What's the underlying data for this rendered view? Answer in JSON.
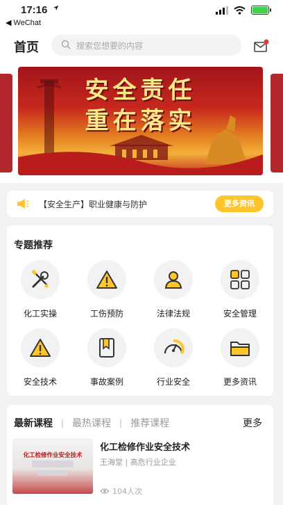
{
  "status": {
    "time": "17:16",
    "back_app": "◀ WeChat"
  },
  "header": {
    "title": "首页",
    "search_placeholder": "搜索您想要的内容"
  },
  "banner": {
    "line1": "安全责任",
    "line2": "重在落实"
  },
  "notice": {
    "text": "【安全生产】职业健康与防护",
    "more_button": "更多资讯"
  },
  "topics": {
    "title": "专题推荐",
    "items": [
      {
        "label": "化工实操",
        "icon": "tools-icon"
      },
      {
        "label": "工伤预防",
        "icon": "warning-icon"
      },
      {
        "label": "法律法规",
        "icon": "user-icon"
      },
      {
        "label": "安全管理",
        "icon": "grid-icon"
      },
      {
        "label": "安全技术",
        "icon": "warning-icon"
      },
      {
        "label": "事故案例",
        "icon": "bookmark-icon"
      },
      {
        "label": "行业安全",
        "icon": "gauge-icon"
      },
      {
        "label": "更多资讯",
        "icon": "folder-icon"
      }
    ]
  },
  "courses": {
    "tabs": [
      "最新课程",
      "最热课程",
      "推荐课程"
    ],
    "more": "更多",
    "items": [
      {
        "title": "化工检修作业安全技术",
        "subtitle": "王海堂 | 高危行业企业",
        "views": "104人次",
        "thumb_title": "化工检修作业安全技术"
      }
    ]
  },
  "colors": {
    "accent": "#ffc52b",
    "banner_red": "#b3282c"
  }
}
